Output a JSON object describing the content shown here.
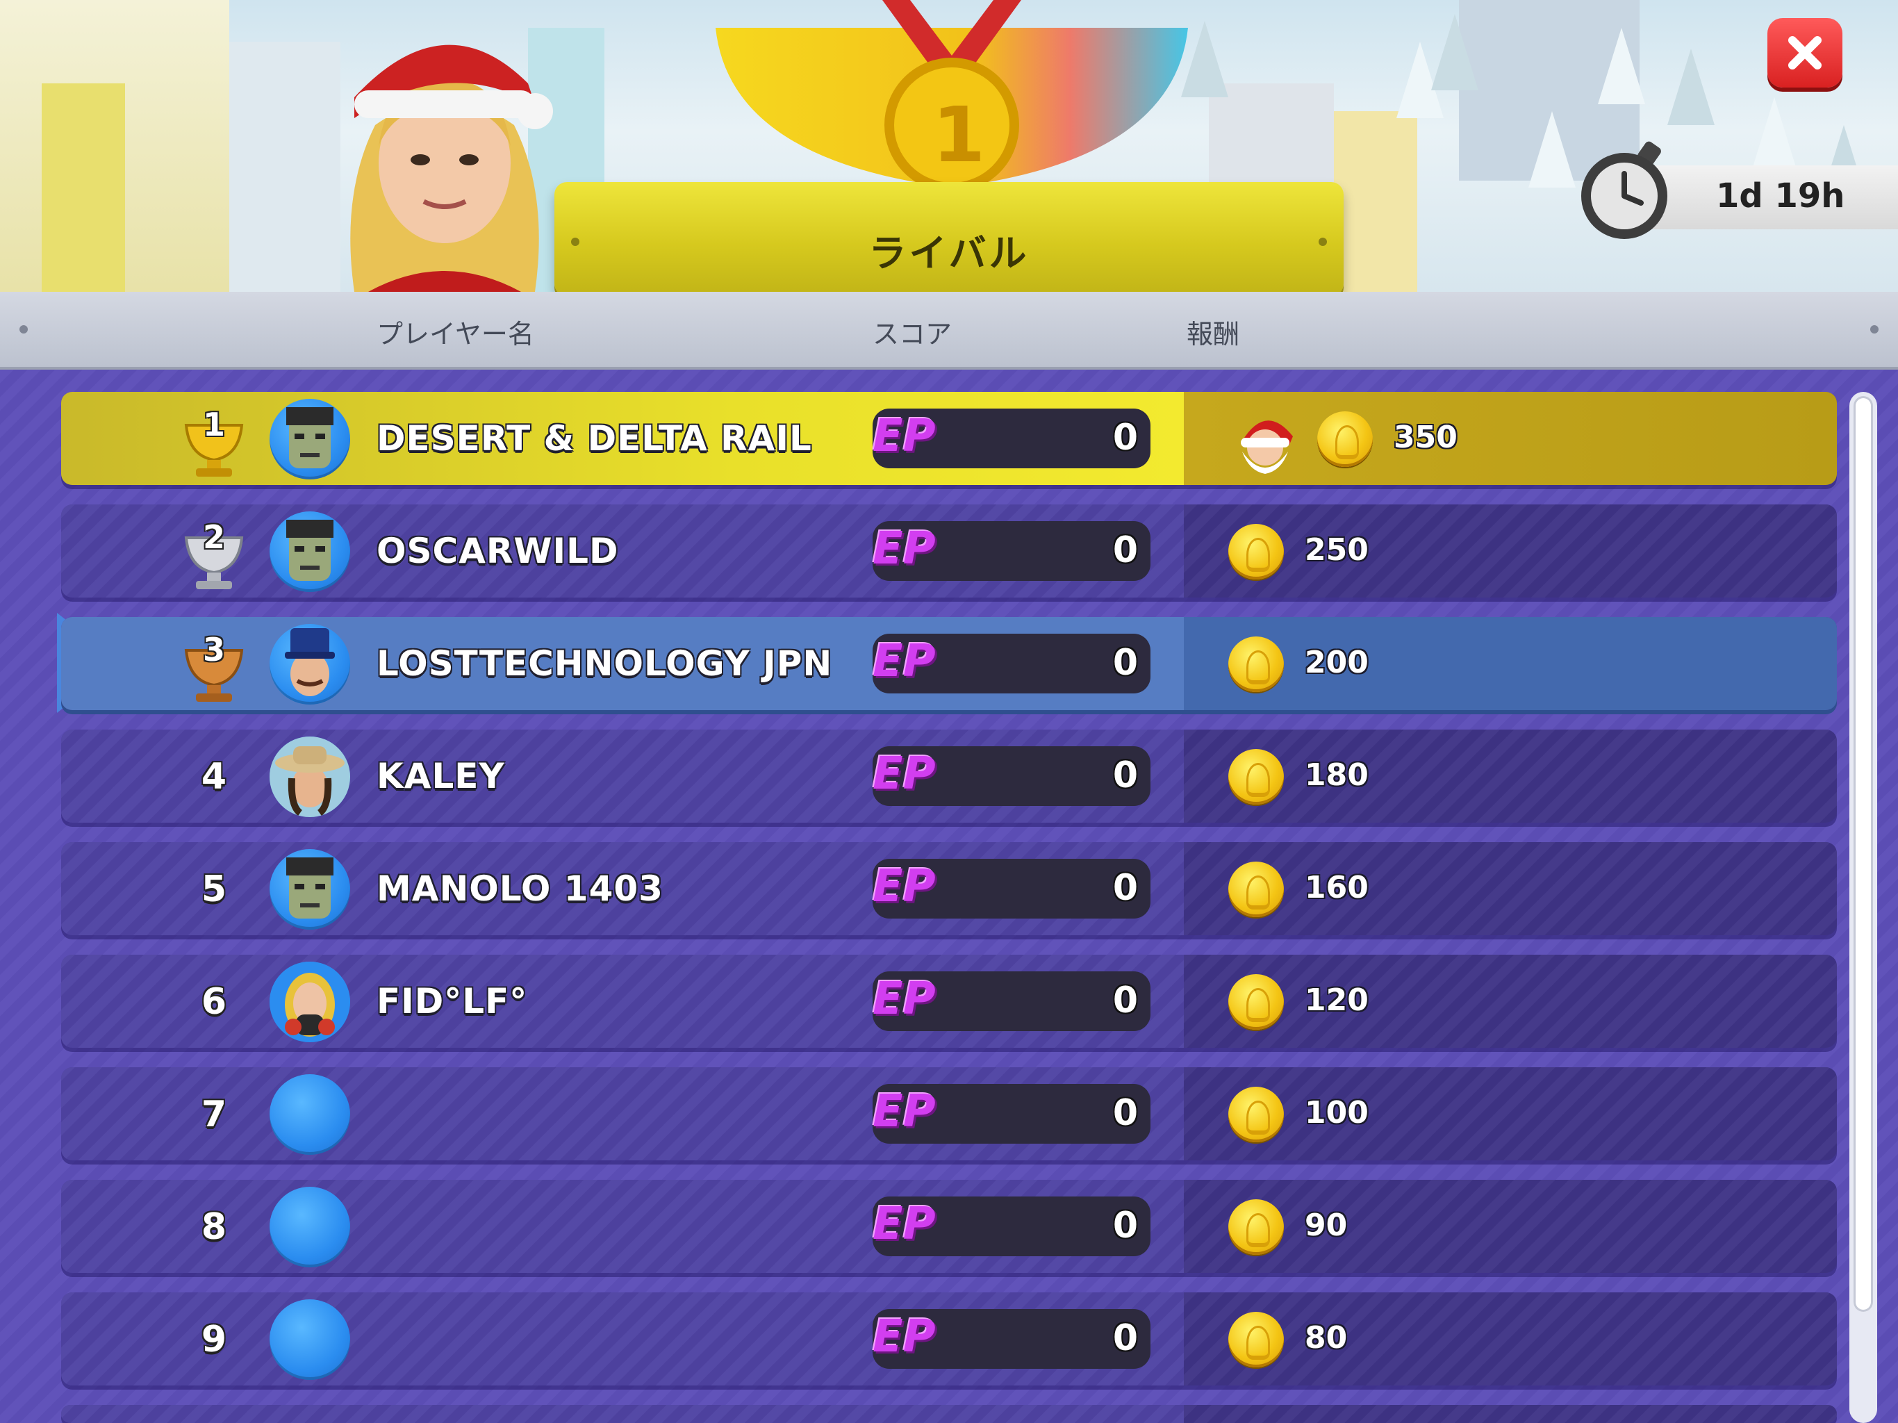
{
  "header": {
    "title": "ライバル",
    "trophy_place": "1",
    "timer": "1d 19h"
  },
  "columns": {
    "player": "プレイヤー名",
    "score": "スコア",
    "reward": "報酬"
  },
  "score_badge": "EP",
  "rows": [
    {
      "rank": "1",
      "name": "DESERT & DELTA RAIL",
      "score": "0",
      "reward": "350",
      "trophy": "gold",
      "avatar": "frankenstein",
      "extra_reward": "santa-icon"
    },
    {
      "rank": "2",
      "name": "OSCARWILD",
      "score": "0",
      "reward": "250",
      "trophy": "silver",
      "avatar": "frankenstein"
    },
    {
      "rank": "3",
      "name": "LOSTTECHNOLOGY JPN",
      "score": "0",
      "reward": "200",
      "trophy": "bronze",
      "avatar": "conductor",
      "current_player": true
    },
    {
      "rank": "4",
      "name": "KALEY",
      "score": "0",
      "reward": "180",
      "avatar": "woman-hat"
    },
    {
      "rank": "5",
      "name": "MANOLO 1403",
      "score": "0",
      "reward": "160",
      "avatar": "frankenstein"
    },
    {
      "rank": "6",
      "name": "FID°LF°",
      "score": "0",
      "reward": "120",
      "avatar": "gasmask"
    },
    {
      "rank": "7",
      "name": "",
      "score": "0",
      "reward": "100",
      "avatar": "blank"
    },
    {
      "rank": "8",
      "name": "",
      "score": "0",
      "reward": "90",
      "avatar": "blank"
    },
    {
      "rank": "9",
      "name": "",
      "score": "0",
      "reward": "80",
      "avatar": "blank"
    }
  ],
  "colors": {
    "list_bg": "#5d4fb8",
    "first_row": "#e9e02a",
    "current_row": "#567dc3",
    "ep": "#d23ef0",
    "coin": "#f4c514",
    "close": "#d92121"
  }
}
